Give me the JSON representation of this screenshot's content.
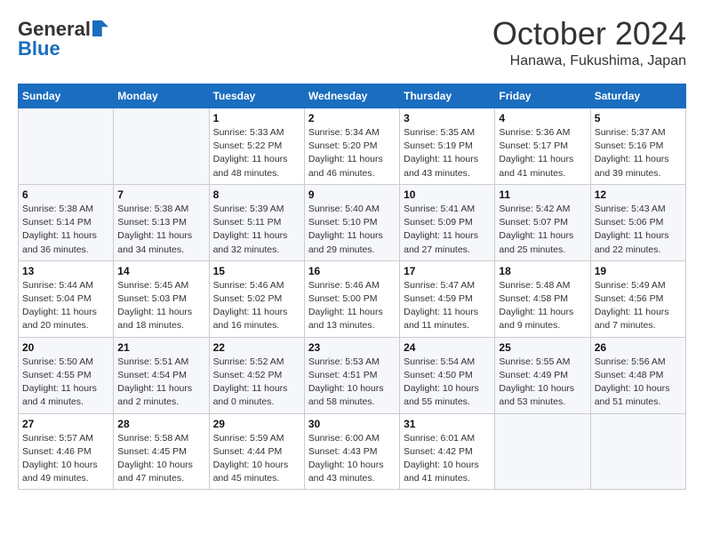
{
  "header": {
    "logo_general": "General",
    "logo_blue": "Blue",
    "month_title": "October 2024",
    "location": "Hanawa, Fukushima, Japan"
  },
  "days_of_week": [
    "Sunday",
    "Monday",
    "Tuesday",
    "Wednesday",
    "Thursday",
    "Friday",
    "Saturday"
  ],
  "weeks": [
    [
      {
        "day": "",
        "info": ""
      },
      {
        "day": "",
        "info": ""
      },
      {
        "day": "1",
        "info": "Sunrise: 5:33 AM\nSunset: 5:22 PM\nDaylight: 11 hours\nand 48 minutes."
      },
      {
        "day": "2",
        "info": "Sunrise: 5:34 AM\nSunset: 5:20 PM\nDaylight: 11 hours\nand 46 minutes."
      },
      {
        "day": "3",
        "info": "Sunrise: 5:35 AM\nSunset: 5:19 PM\nDaylight: 11 hours\nand 43 minutes."
      },
      {
        "day": "4",
        "info": "Sunrise: 5:36 AM\nSunset: 5:17 PM\nDaylight: 11 hours\nand 41 minutes."
      },
      {
        "day": "5",
        "info": "Sunrise: 5:37 AM\nSunset: 5:16 PM\nDaylight: 11 hours\nand 39 minutes."
      }
    ],
    [
      {
        "day": "6",
        "info": "Sunrise: 5:38 AM\nSunset: 5:14 PM\nDaylight: 11 hours\nand 36 minutes."
      },
      {
        "day": "7",
        "info": "Sunrise: 5:38 AM\nSunset: 5:13 PM\nDaylight: 11 hours\nand 34 minutes."
      },
      {
        "day": "8",
        "info": "Sunrise: 5:39 AM\nSunset: 5:11 PM\nDaylight: 11 hours\nand 32 minutes."
      },
      {
        "day": "9",
        "info": "Sunrise: 5:40 AM\nSunset: 5:10 PM\nDaylight: 11 hours\nand 29 minutes."
      },
      {
        "day": "10",
        "info": "Sunrise: 5:41 AM\nSunset: 5:09 PM\nDaylight: 11 hours\nand 27 minutes."
      },
      {
        "day": "11",
        "info": "Sunrise: 5:42 AM\nSunset: 5:07 PM\nDaylight: 11 hours\nand 25 minutes."
      },
      {
        "day": "12",
        "info": "Sunrise: 5:43 AM\nSunset: 5:06 PM\nDaylight: 11 hours\nand 22 minutes."
      }
    ],
    [
      {
        "day": "13",
        "info": "Sunrise: 5:44 AM\nSunset: 5:04 PM\nDaylight: 11 hours\nand 20 minutes."
      },
      {
        "day": "14",
        "info": "Sunrise: 5:45 AM\nSunset: 5:03 PM\nDaylight: 11 hours\nand 18 minutes."
      },
      {
        "day": "15",
        "info": "Sunrise: 5:46 AM\nSunset: 5:02 PM\nDaylight: 11 hours\nand 16 minutes."
      },
      {
        "day": "16",
        "info": "Sunrise: 5:46 AM\nSunset: 5:00 PM\nDaylight: 11 hours\nand 13 minutes."
      },
      {
        "day": "17",
        "info": "Sunrise: 5:47 AM\nSunset: 4:59 PM\nDaylight: 11 hours\nand 11 minutes."
      },
      {
        "day": "18",
        "info": "Sunrise: 5:48 AM\nSunset: 4:58 PM\nDaylight: 11 hours\nand 9 minutes."
      },
      {
        "day": "19",
        "info": "Sunrise: 5:49 AM\nSunset: 4:56 PM\nDaylight: 11 hours\nand 7 minutes."
      }
    ],
    [
      {
        "day": "20",
        "info": "Sunrise: 5:50 AM\nSunset: 4:55 PM\nDaylight: 11 hours\nand 4 minutes."
      },
      {
        "day": "21",
        "info": "Sunrise: 5:51 AM\nSunset: 4:54 PM\nDaylight: 11 hours\nand 2 minutes."
      },
      {
        "day": "22",
        "info": "Sunrise: 5:52 AM\nSunset: 4:52 PM\nDaylight: 11 hours\nand 0 minutes."
      },
      {
        "day": "23",
        "info": "Sunrise: 5:53 AM\nSunset: 4:51 PM\nDaylight: 10 hours\nand 58 minutes."
      },
      {
        "day": "24",
        "info": "Sunrise: 5:54 AM\nSunset: 4:50 PM\nDaylight: 10 hours\nand 55 minutes."
      },
      {
        "day": "25",
        "info": "Sunrise: 5:55 AM\nSunset: 4:49 PM\nDaylight: 10 hours\nand 53 minutes."
      },
      {
        "day": "26",
        "info": "Sunrise: 5:56 AM\nSunset: 4:48 PM\nDaylight: 10 hours\nand 51 minutes."
      }
    ],
    [
      {
        "day": "27",
        "info": "Sunrise: 5:57 AM\nSunset: 4:46 PM\nDaylight: 10 hours\nand 49 minutes."
      },
      {
        "day": "28",
        "info": "Sunrise: 5:58 AM\nSunset: 4:45 PM\nDaylight: 10 hours\nand 47 minutes."
      },
      {
        "day": "29",
        "info": "Sunrise: 5:59 AM\nSunset: 4:44 PM\nDaylight: 10 hours\nand 45 minutes."
      },
      {
        "day": "30",
        "info": "Sunrise: 6:00 AM\nSunset: 4:43 PM\nDaylight: 10 hours\nand 43 minutes."
      },
      {
        "day": "31",
        "info": "Sunrise: 6:01 AM\nSunset: 4:42 PM\nDaylight: 10 hours\nand 41 minutes."
      },
      {
        "day": "",
        "info": ""
      },
      {
        "day": "",
        "info": ""
      }
    ]
  ]
}
